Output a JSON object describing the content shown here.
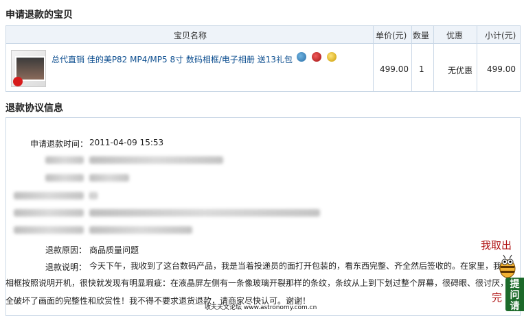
{
  "sections": {
    "refund_items_title": "申请退款的宝贝",
    "agreement_title": "退款协议信息"
  },
  "product_table": {
    "headers": {
      "name": "宝贝名称",
      "unit_price": "单价(元)",
      "quantity": "数量",
      "discount": "优惠",
      "subtotal": "小计(元)"
    },
    "row": {
      "name": "总代直销 佳的美P82 MP4/MP5 8寸 数码相框/电子相册 送13礼包",
      "unit_price": "499.00",
      "quantity": "1",
      "discount": "无优惠",
      "subtotal": "499.00",
      "badge_icons": [
        "consumer-guarantee-icon",
        "seven-day-return-icon",
        "genuine-guarantee-icon"
      ]
    }
  },
  "agreement": {
    "apply_time_label": "申请退款时间：",
    "apply_time_value": "2011-04-09 15:53",
    "reason_label": "退款原因：",
    "reason_value": "商品质量问题",
    "explain_label": "退款说明：",
    "explain_line1": "今天下午，我收到了这台数码产品，我是当着投递员的面打开包装的，看东西完整、齐全然后签收的。在家里，我",
    "explain_line2": "相框按照说明开机，很快就发现有明显瑕疵：在液晶屏左侧有一条像玻璃开裂那样的条纹，条纹从上到下划过整个屏幕，很碍眼、很讨厌，",
    "explain_line3": "全破坏了画面的完整性和欣赏性！我不得不要求退货退款，请商家尽快认可。谢谢！"
  },
  "widget": {
    "take_out_text": "我取出",
    "side_text": "完",
    "button_text": "提问请"
  },
  "watermark": "收天天文论坛 www.astronomy.com.cn"
}
